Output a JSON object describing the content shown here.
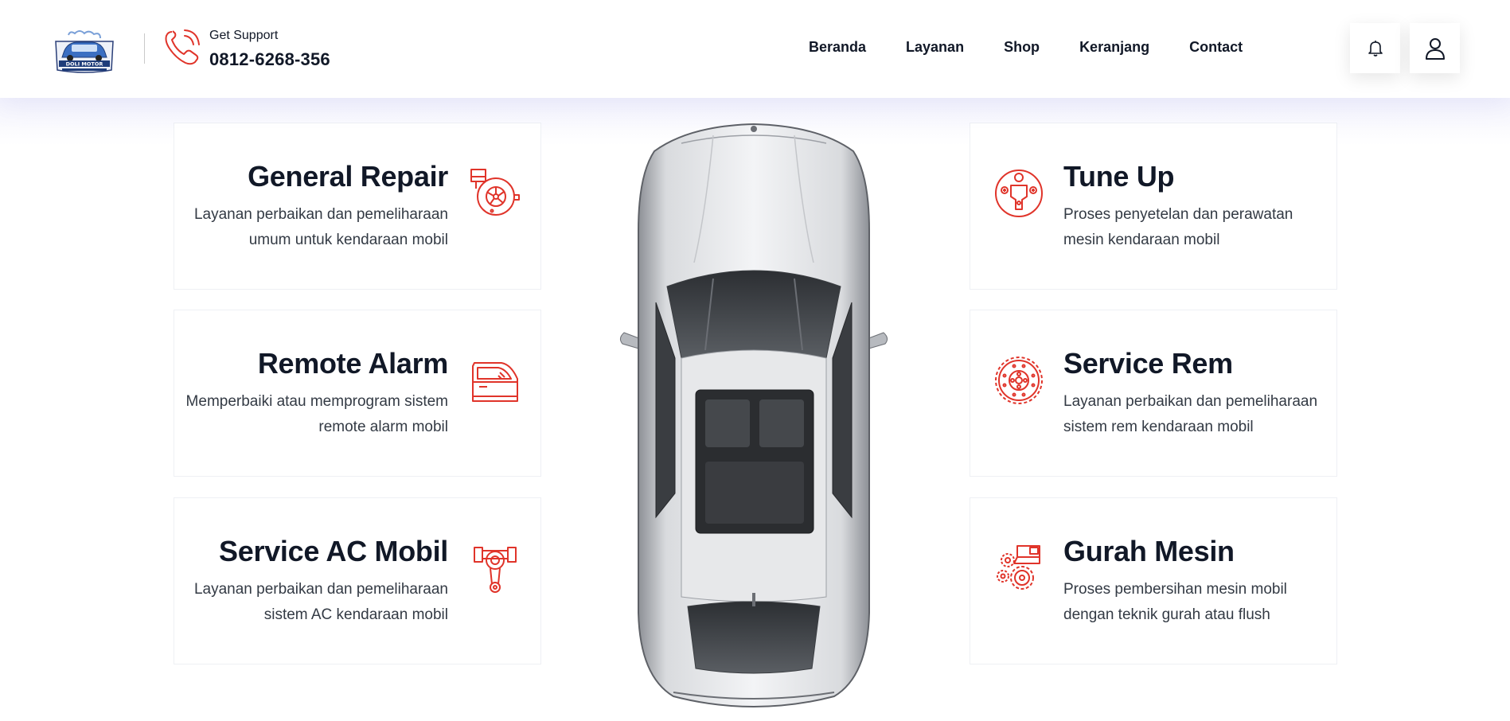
{
  "header": {
    "logo_text": "DOLI MOTOR",
    "support_label": "Get Support",
    "support_phone": "0812-6268-356",
    "nav": [
      "Beranda",
      "Layanan",
      "Shop",
      "Keranjang",
      "Contact"
    ],
    "icons": [
      "phone-icon",
      "bell-icon",
      "user-icon"
    ]
  },
  "services": {
    "left": [
      {
        "title": "General Repair",
        "desc": "Layanan perbaikan dan pemeliharaan umum untuk kendaraan mobil",
        "icon": "turbo-icon"
      },
      {
        "title": "Remote Alarm",
        "desc": "Memperbaiki atau memprogram sistem remote alarm mobil",
        "icon": "car-door-icon"
      },
      {
        "title": "Service AC Mobil",
        "desc": "Layanan perbaikan dan pemeliharaan sistem AC kendaraan mobil",
        "icon": "piston-icon"
      }
    ],
    "right": [
      {
        "title": "Tune Up",
        "desc": "Proses penyetelan dan perawatan mesin kendaraan mobil",
        "icon": "engine-gauge-icon"
      },
      {
        "title": "Service Rem",
        "desc": "Layanan perbaikan dan pemeliharaan sistem rem kendaraan mobil",
        "icon": "brake-disc-icon"
      },
      {
        "title": "Gurah Mesin",
        "desc": "Proses pembersihan mesin mobil dengan teknik gurah atau flush",
        "icon": "engine-gears-icon"
      }
    ]
  },
  "colors": {
    "accent": "#e0342a",
    "text": "#111827",
    "muted": "#333a44"
  }
}
